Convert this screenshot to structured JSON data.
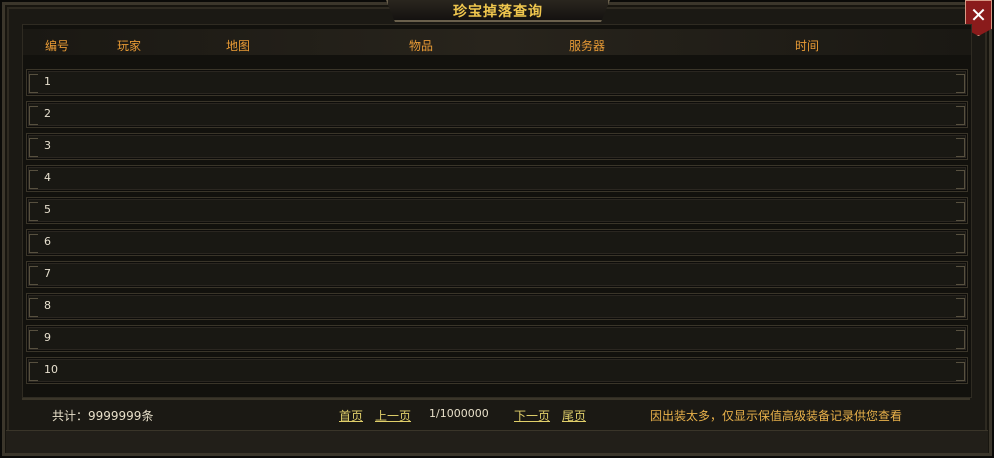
{
  "window": {
    "title": "珍宝掉落查询"
  },
  "table": {
    "headers": [
      "编号",
      "玩家",
      "地图",
      "物品",
      "服务器",
      "时间"
    ],
    "rows": [
      "1",
      "2",
      "3",
      "4",
      "5",
      "6",
      "7",
      "8",
      "9",
      "10"
    ]
  },
  "footer": {
    "total": "共计：9999999条",
    "first": "首页",
    "prev": "上一页",
    "page": "1/1000000",
    "next": "下一页",
    "last": "尾页",
    "notice": "因出装太多，仅显示保值高级装备记录供您查看"
  }
}
